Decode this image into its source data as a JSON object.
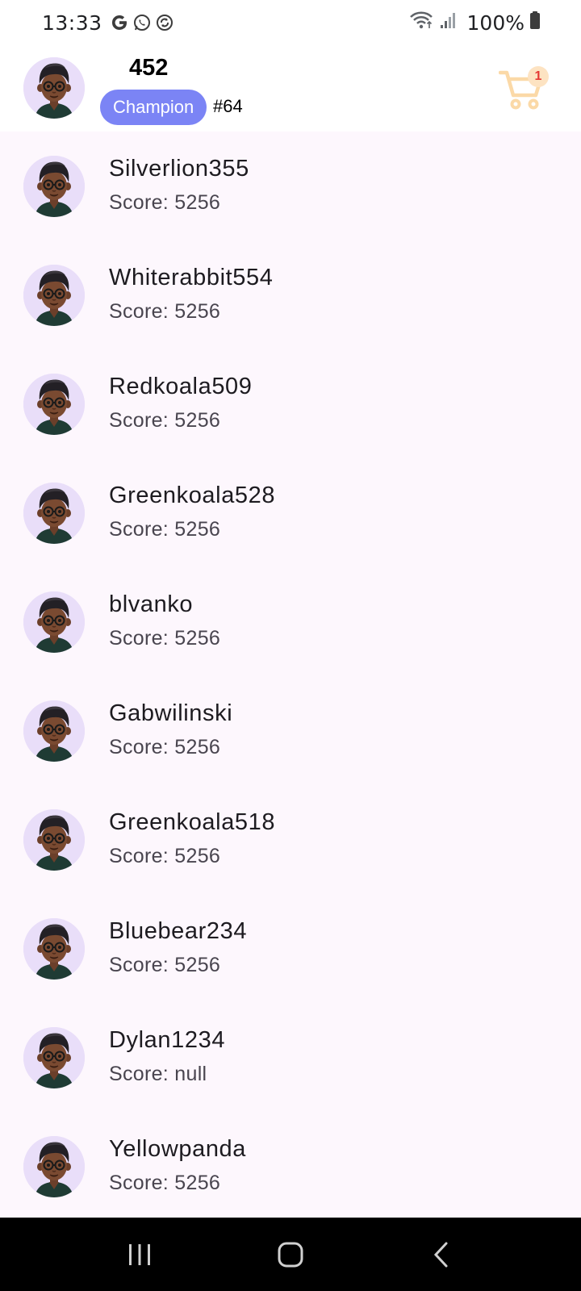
{
  "status_bar": {
    "time": "13:33",
    "battery": "100%",
    "app_icons": [
      "google-icon",
      "whatsapp-icon",
      "sync-icon"
    ],
    "system_icons": [
      "wifi-icon",
      "signal-icon",
      "battery-icon"
    ]
  },
  "header": {
    "score": "452",
    "rank_label": "Champion",
    "rank_position": "#64",
    "cart_count": "1",
    "cart_icon": "cart-icon",
    "colors": {
      "badge_bg": "#7b84f5",
      "cart_icon": "#fbd9a7",
      "cart_badge_bg": "#fde3c2",
      "cart_badge_text": "#e53935"
    }
  },
  "players": [
    {
      "name": "Silverlion355",
      "score": "Score: 5256"
    },
    {
      "name": "Whiterabbit554",
      "score": "Score: 5256"
    },
    {
      "name": "Redkoala509",
      "score": "Score: 5256"
    },
    {
      "name": "Greenkoala528",
      "score": "Score: 5256"
    },
    {
      "name": "blvanko",
      "score": "Score: 5256"
    },
    {
      "name": "Gabwilinski",
      "score": "Score: 5256"
    },
    {
      "name": "Greenkoala518",
      "score": "Score: 5256"
    },
    {
      "name": "Bluebear234",
      "score": "Score: 5256"
    },
    {
      "name": "Dylan1234",
      "score": "Score: null"
    },
    {
      "name": "Yellowpanda",
      "score": "Score: 5256"
    }
  ],
  "nav_bar": {
    "buttons": [
      "recents-icon",
      "home-icon",
      "back-icon"
    ]
  }
}
